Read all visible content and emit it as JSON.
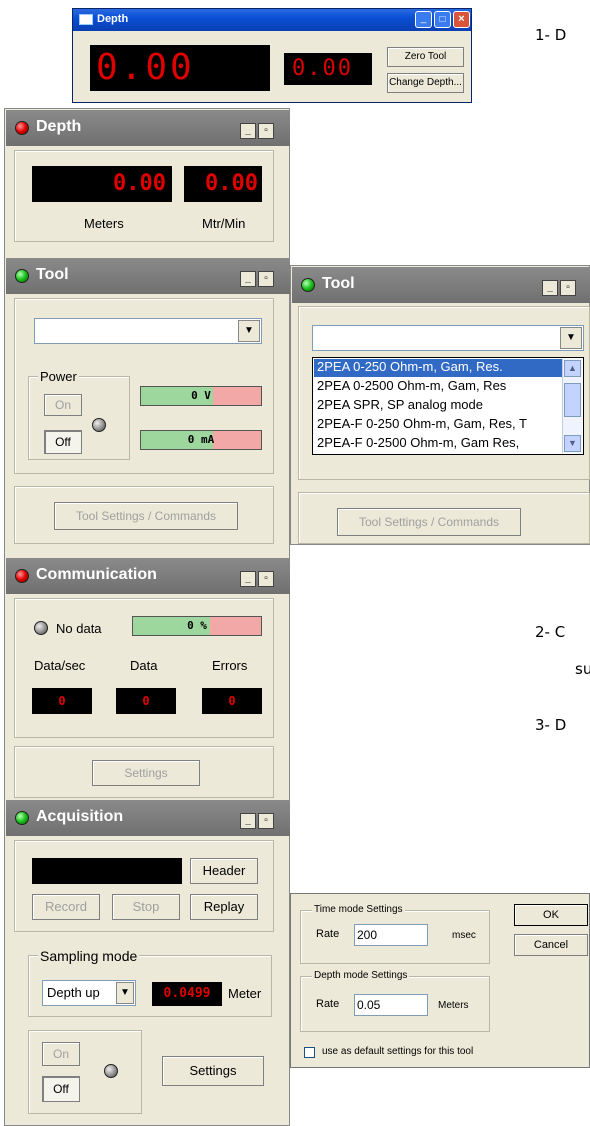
{
  "top_window": {
    "title": "Depth",
    "depth_value": "0.00",
    "speed_value": "0.00",
    "zero_tool": "Zero Tool",
    "change_depth": "Change Depth..."
  },
  "side_notes": {
    "n1": "1-  D",
    "n2": "2-  C",
    "n2b": "su",
    "n3": "3-  D"
  },
  "depth_panel": {
    "title": "Depth",
    "depth": "0.00",
    "speed": "0.00",
    "meters": "Meters",
    "mtr_min": "Mtr/Min"
  },
  "tool_panel": {
    "title": "Tool",
    "power": "Power",
    "on": "On",
    "off": "Off",
    "voltage": "0 V",
    "current": "0 mA",
    "settings_btn": "Tool Settings / Commands"
  },
  "tool_dropdown": {
    "title": "Tool",
    "items": [
      "2PEA 0-250 Ohm-m, Gam, Res.",
      "2PEA 0-2500 Ohm-m, Gam, Res",
      "2PEA SPR, SP analog mode",
      "2PEA-F 0-250 Ohm-m, Gam, Res, T",
      "2PEA-F 0-2500 Ohm-m, Gam Res,"
    ],
    "settings_btn": "Tool Settings / Commands"
  },
  "comm_panel": {
    "title": "Communication",
    "status": "No data",
    "percent": "0 %",
    "data_sec": "Data/sec",
    "data": "Data",
    "errors": "Errors",
    "v1": "0",
    "v2": "0",
    "v3": "0",
    "settings": "Settings"
  },
  "acq_panel": {
    "title": "Acquisition",
    "header": "Header",
    "record": "Record",
    "stop": "Stop",
    "replay": "Replay",
    "sampling_mode": "Sampling mode",
    "mode": "Depth up",
    "mode_value": "0.0499",
    "unit": "Meter",
    "on": "On",
    "off": "Off",
    "settings": "Settings"
  },
  "settings_dialog": {
    "time_mode": "Time mode Settings",
    "rate": "Rate",
    "time_rate": "200",
    "msec": "msec",
    "depth_mode": "Depth mode Settings",
    "depth_rate": "0.05",
    "meters": "Meters",
    "ok": "OK",
    "cancel": "Cancel",
    "default_cb": "use as default settings for this tool"
  }
}
